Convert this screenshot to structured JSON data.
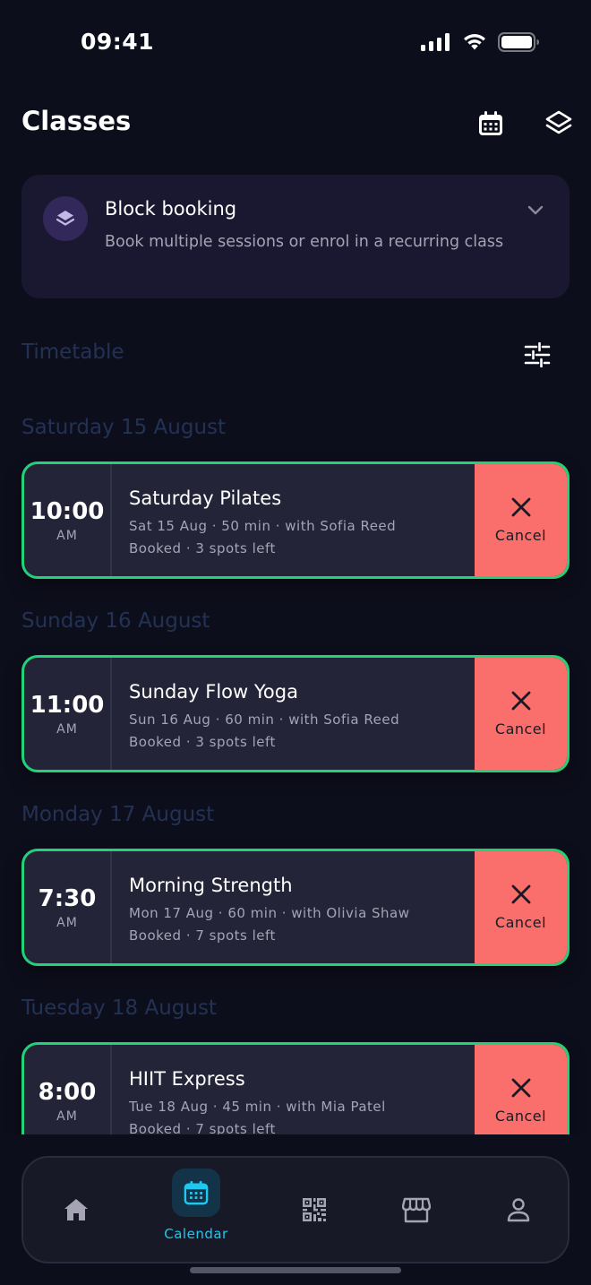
{
  "status_bar": {
    "time": "09:41"
  },
  "header": {
    "title": "Classes"
  },
  "block_booking": {
    "title": "Block booking",
    "description": "Book multiple sessions or enrol in a recurring class"
  },
  "timetable": {
    "label": "Timetable"
  },
  "days": [
    {
      "heading": "Saturday 15 August",
      "class": {
        "time": "10:00",
        "ampm": "AM",
        "name": "Saturday Pilates",
        "meta": "Sat 15 Aug · 50 min · with Sofia Reed",
        "status": "Booked · 3 spots left",
        "cancel_label": "Cancel"
      }
    },
    {
      "heading": "Sunday 16 August",
      "class": {
        "time": "11:00",
        "ampm": "AM",
        "name": "Sunday Flow Yoga",
        "meta": "Sun 16 Aug · 60 min · with Sofia Reed",
        "status": "Booked · 3 spots left",
        "cancel_label": "Cancel"
      }
    },
    {
      "heading": "Monday 17 August",
      "class": {
        "time": "7:30",
        "ampm": "AM",
        "name": "Morning Strength",
        "meta": "Mon 17 Aug · 60 min · with Olivia Shaw",
        "status": "Booked · 7 spots left",
        "cancel_label": "Cancel"
      }
    },
    {
      "heading": "Tuesday 18 August",
      "class": {
        "time": "8:00",
        "ampm": "AM",
        "name": "HIIT Express",
        "meta": "Tue 18 Aug · 45 min · with Mia Patel",
        "status": "Booked · 7 spots left",
        "cancel_label": "Cancel"
      }
    }
  ],
  "nav": {
    "items": [
      {
        "icon": "home-icon"
      },
      {
        "icon": "calendar-icon",
        "label": "Calendar",
        "active": true
      },
      {
        "icon": "qr-code-icon"
      },
      {
        "icon": "store-icon"
      },
      {
        "icon": "profile-icon"
      }
    ]
  },
  "colors": {
    "background": "#0d0e1b",
    "booked_border": "#22d278",
    "cancel": "#fa6e6b",
    "accent": "#1ec8f0",
    "muted_heading": "#233254"
  }
}
